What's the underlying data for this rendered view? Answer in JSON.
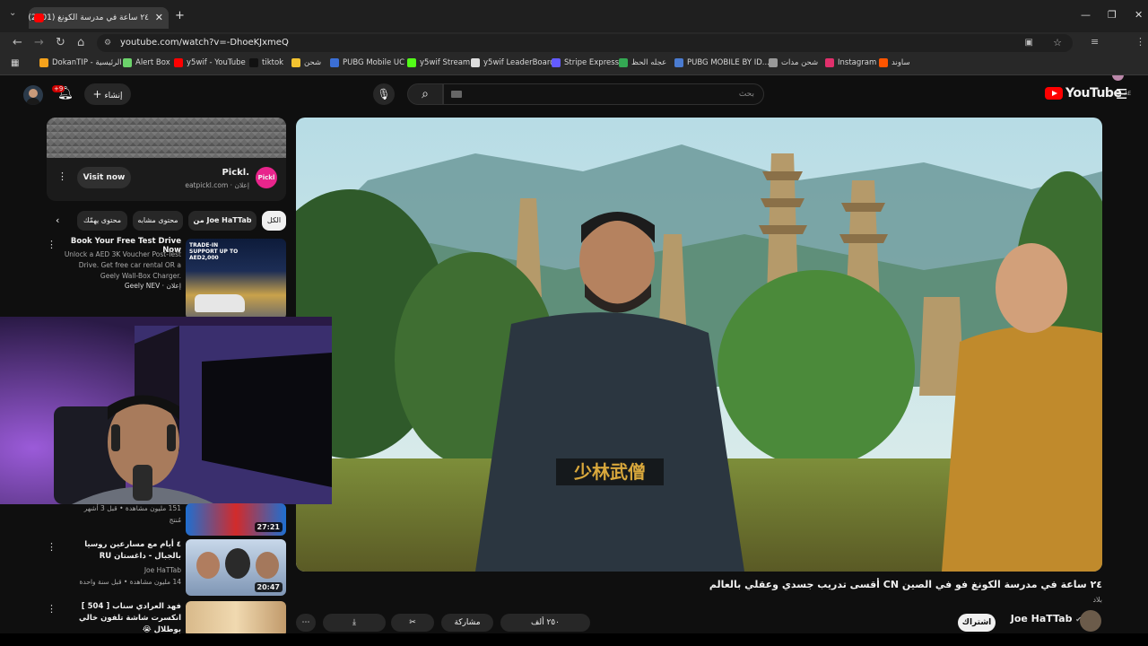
{
  "browser": {
    "tab_title": "٢٤ ساعة في مدرسة الكونغ (2401)",
    "url": "youtube.com/watch?v=-DhoeKJxmeQ",
    "bookmarks": [
      {
        "label": "DokanTIP - الرئيسية",
        "color": "#f4a21c"
      },
      {
        "label": "Alert Box",
        "color": "#6cd36b"
      },
      {
        "label": "y5wif - YouTube",
        "color": "#ff0000"
      },
      {
        "label": "tiktok",
        "color": "#111111"
      },
      {
        "label": "شحن",
        "color": "#f2c230"
      },
      {
        "label": "PUBG Mobile UC",
        "color": "#3b6fd6"
      },
      {
        "label": "y5wif Stream",
        "color": "#53fc18"
      },
      {
        "label": "y5wif LeaderBoard",
        "color": "#dddddd"
      },
      {
        "label": "Stripe Express",
        "color": "#635bff"
      },
      {
        "label": "عجله الحظ",
        "color": "#34a853"
      },
      {
        "label": "PUBG MOBILE BY ID...",
        "color": "#4a7bd0"
      },
      {
        "label": "شحن مدات",
        "color": "#999999"
      },
      {
        "label": "Instagram",
        "color": "#e1306c"
      },
      {
        "label": "ساوند",
        "color": "#ff5500"
      }
    ]
  },
  "header": {
    "logo": "YouTube",
    "region": "AE",
    "search_placeholder": "بحث",
    "create_label": "إنشاء",
    "notifications": "+9"
  },
  "video": {
    "title": "٢٤ ساعة في مدرسة الكونغ فو في الصين CN أقسى تدريب جسدي وعقلي بالعالم",
    "subtitle": "بلاد",
    "channel": "Joe HaTTab",
    "belt_text": "少林武僧"
  },
  "sidebar": {
    "ad": {
      "name": "Pickl.",
      "logo": "Pickl",
      "meta": "إعلان · eatpickl.com",
      "button": "Visit now"
    },
    "chips": [
      "الكل",
      "من Joe HaTTab",
      "محتوى مشابه",
      "محتوى يهمّك"
    ],
    "promo": {
      "title": "Book Your Free Test Drive Now",
      "desc": "Unlock a AED 3K Voucher Post-Test Drive. Get free car rental OR a Geely Wall-Box Charger.",
      "meta": "إعلان · Geely NEV",
      "thumb_text": "TRADE-IN SUPPORT UP TO AED2,000"
    },
    "items": [
      {
        "title": "",
        "meta": "151 مليون مشاهدة • قبل 3 أشهر",
        "channel": "مُنتج",
        "duration": "27:21"
      },
      {
        "title": "٤ أيام مع مسارعين روسيا بالجبال - داغستان RU",
        "channel": "Joe HaTTab",
        "meta": "14 مليون مشاهدة • قبل سنة واحدة",
        "duration": "20:47"
      },
      {
        "title": "فهد العرادي سناب [ 504 ] انكسرت شاشة تلفون خالي بوطلال 😭",
        "channel": "",
        "meta": "",
        "duration": ""
      }
    ]
  },
  "actions": [
    "٢٥٠ ألف",
    "مشاركة",
    "حفظ",
    "..."
  ],
  "subscribe_label": "اشتراك"
}
